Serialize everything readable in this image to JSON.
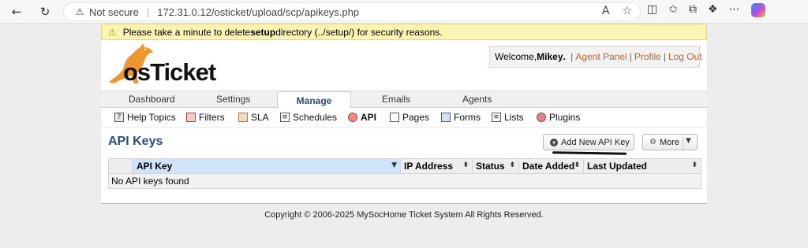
{
  "browser": {
    "security_label": "Not secure",
    "url": "172.31.0.12/osticket/upload/scp/apikeys.php"
  },
  "notice": {
    "prefix": "Please take a minute to delete ",
    "bold": "setup",
    "suffix": " directory (../setup/) for security reasons."
  },
  "logo": {
    "text": "osTicket"
  },
  "welcome": {
    "greeting": "Welcome, ",
    "user": "Mikey",
    "links": [
      "Agent Panel",
      "Profile",
      "Log Out"
    ]
  },
  "nav": {
    "tabs": [
      "Dashboard",
      "Settings",
      "Manage",
      "Emails",
      "Agents"
    ],
    "active": "Manage"
  },
  "subnav": {
    "items": [
      "Help Topics",
      "Filters",
      "SLA",
      "Schedules",
      "API",
      "Pages",
      "Forms",
      "Lists",
      "Plugins"
    ],
    "active": "API"
  },
  "page": {
    "title": "API Keys",
    "add_button": "Add New API Key",
    "more_button": "More"
  },
  "table": {
    "headers": [
      "API Key",
      "IP Address",
      "Status",
      "Date Added",
      "Last Updated"
    ],
    "empty_message": "No API keys found"
  },
  "footer": {
    "copyright": "Copyright © 2006-2025 MySocHome Ticket System All Rights Reserved."
  },
  "colors": {
    "accent": "#2c4c7c",
    "link": "#c4632b",
    "notice_bg": "#fcf4b2",
    "active_header": "#cfe4fa"
  }
}
